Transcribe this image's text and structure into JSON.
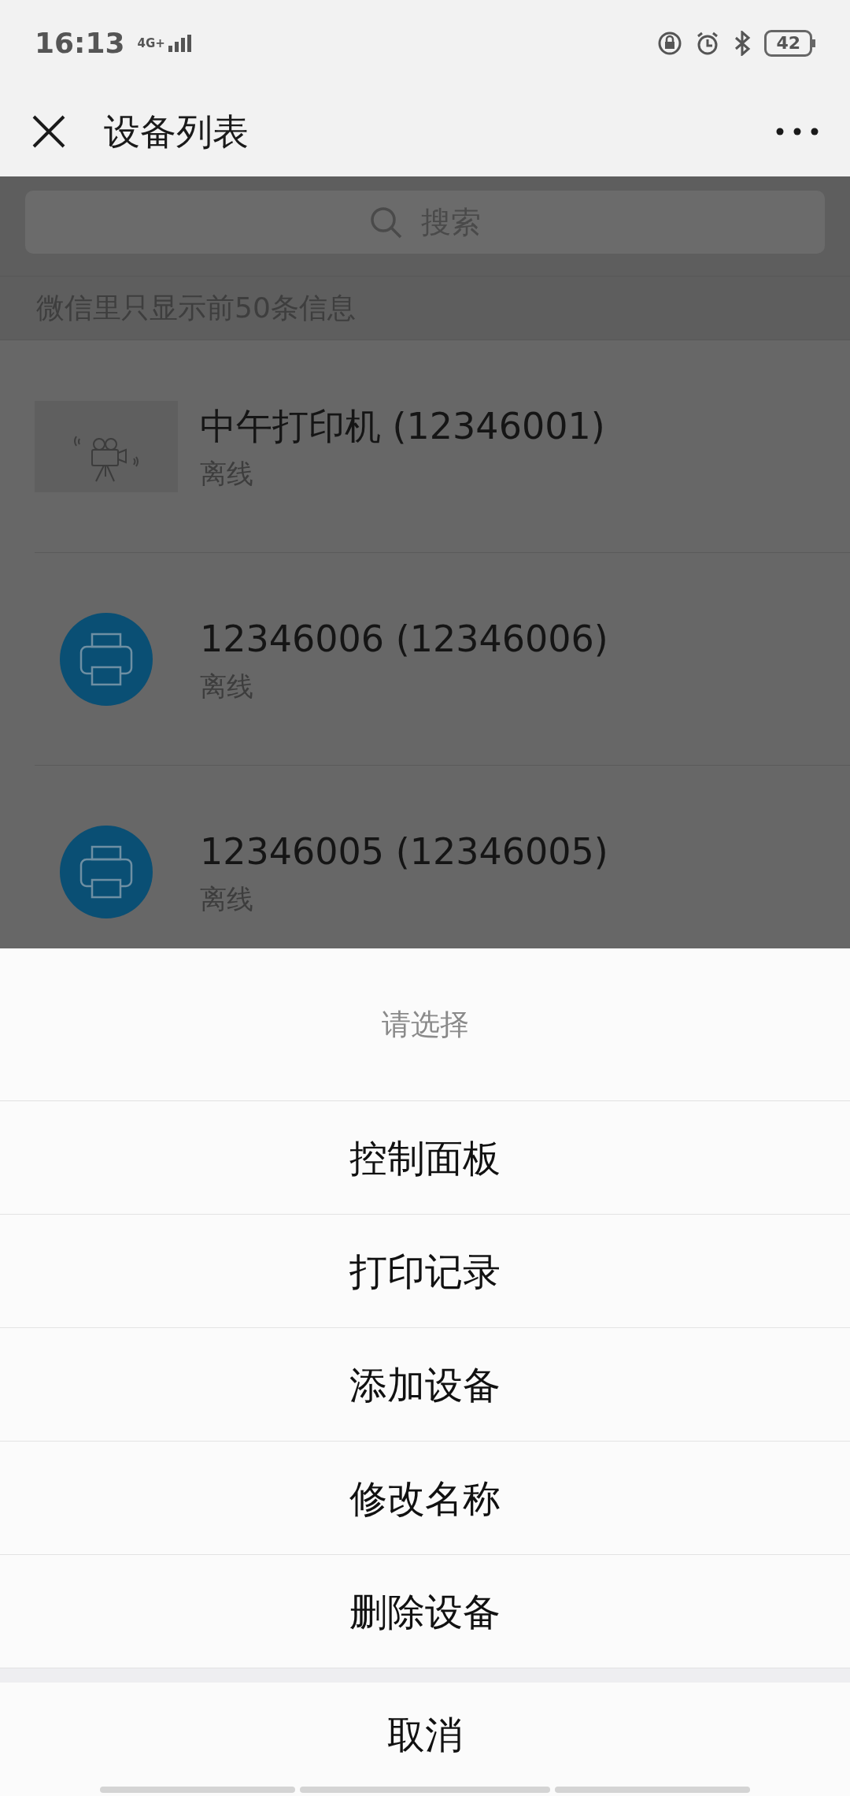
{
  "status_bar": {
    "time": "16:13",
    "network": "4G+",
    "battery": "42"
  },
  "header": {
    "title": "设备列表"
  },
  "search": {
    "placeholder": "搜索"
  },
  "notice": "微信里只显示前50条信息",
  "devices": [
    {
      "kind": "camera",
      "name": "中午打印机 (12346001)",
      "status": "离线"
    },
    {
      "kind": "printer",
      "name": "12346006 (12346006)",
      "status": "离线"
    },
    {
      "kind": "printer",
      "name": "12346005 (12346005)",
      "status": "离线"
    }
  ],
  "action_sheet": {
    "title": "请选择",
    "options": [
      "控制面板",
      "打印记录",
      "添加设备",
      "修改名称",
      "删除设备"
    ],
    "cancel": "取消"
  }
}
